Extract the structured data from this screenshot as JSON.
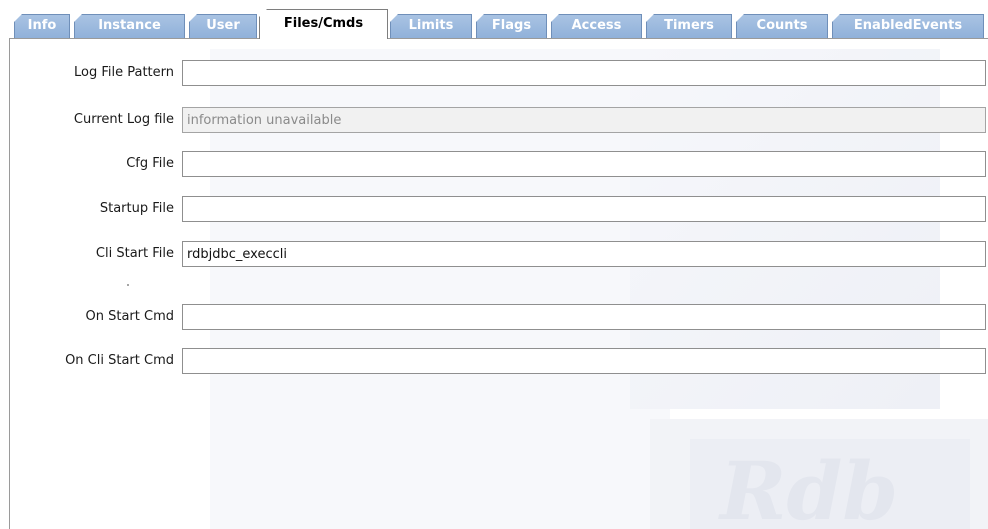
{
  "tabs": [
    {
      "label": "Info",
      "active": false
    },
    {
      "label": "Instance",
      "active": false
    },
    {
      "label": "User",
      "active": false
    },
    {
      "label": "Files/Cmds",
      "active": true
    },
    {
      "label": "Limits",
      "active": false
    },
    {
      "label": "Flags",
      "active": false
    },
    {
      "label": "Access",
      "active": false
    },
    {
      "label": "Timers",
      "active": false
    },
    {
      "label": "Counts",
      "active": false
    },
    {
      "label": "EnabledEvents",
      "active": false
    }
  ],
  "fields": {
    "log_file_pattern": {
      "label": "Log File Pattern",
      "value": ""
    },
    "current_log_file": {
      "label": "Current Log file",
      "value": "",
      "placeholder": "information unavailable",
      "disabled": true
    },
    "cfg_file": {
      "label": "Cfg File",
      "value": ""
    },
    "startup_file": {
      "label": "Startup File",
      "value": ""
    },
    "cli_start_file": {
      "label": "Cli Start File",
      "value": "rdbjdbc_execcli"
    },
    "on_start_cmd": {
      "label": "On Start Cmd",
      "value": ""
    },
    "on_cli_start_cmd": {
      "label": "On Cli Start Cmd",
      "value": ""
    }
  },
  "colors": {
    "tab_inactive": "#8fb0d9",
    "tab_inactive_text": "#ffffff",
    "tab_active": "#ffffff",
    "tab_active_text": "#000000",
    "field_border": "#8f8f8f"
  }
}
